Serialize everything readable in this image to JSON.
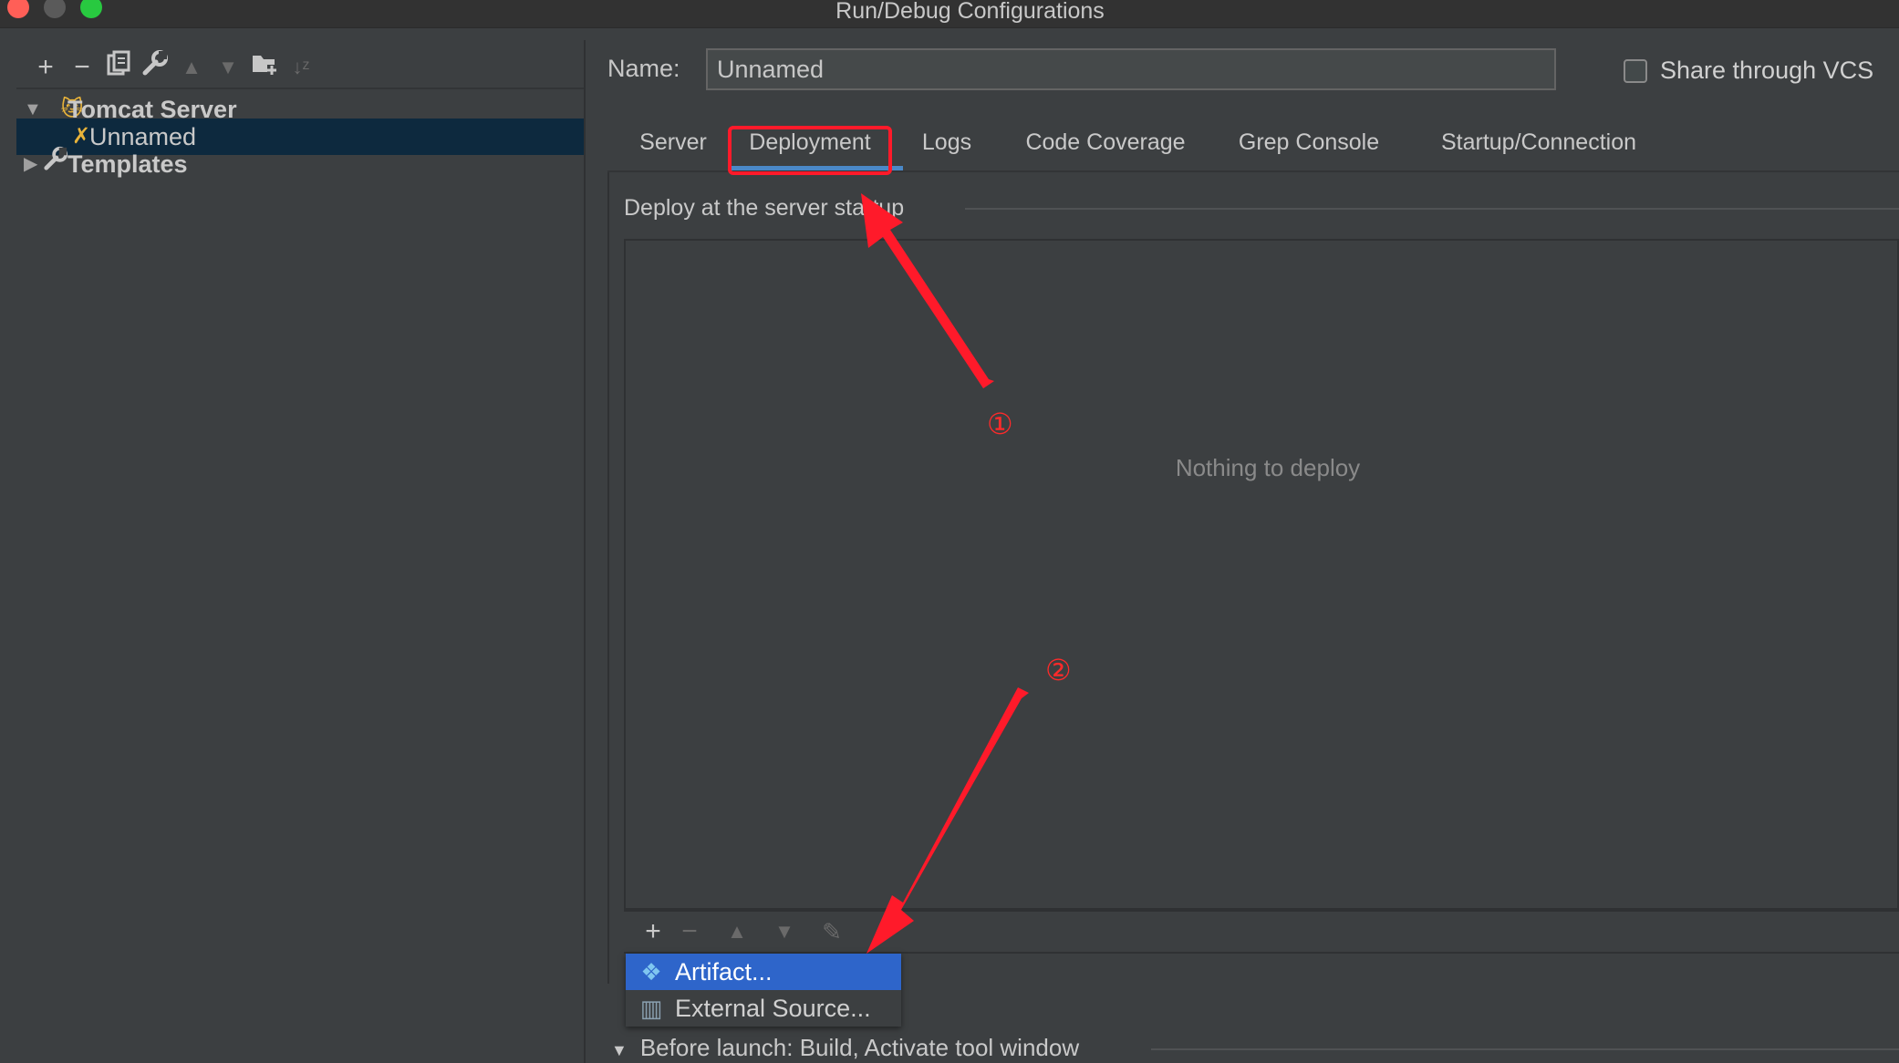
{
  "window": {
    "title": "Run/Debug Configurations"
  },
  "left_toolbar": {
    "icons": [
      "add-icon",
      "remove-icon",
      "copy-icon",
      "wrench-icon",
      "move-up-icon",
      "move-down-icon",
      "folder-add-icon",
      "sort-icon"
    ]
  },
  "tree": {
    "items": [
      {
        "label": "Tomcat Server",
        "expanded": true,
        "icon": "tomcat-icon"
      },
      {
        "label": "Unnamed",
        "selected": true,
        "icon": "tomcat-config-icon"
      },
      {
        "label": "Templates",
        "expanded": false,
        "icon": "wrench-icon"
      }
    ]
  },
  "form": {
    "name_label": "Name:",
    "name_value": "Unnamed",
    "share_label": "Share through VCS",
    "share_checked": false
  },
  "tabs": [
    {
      "label": "Server"
    },
    {
      "label": "Deployment",
      "active": true
    },
    {
      "label": "Logs"
    },
    {
      "label": "Code Coverage"
    },
    {
      "label": "Grep Console"
    },
    {
      "label": "Startup/Connection"
    }
  ],
  "deploy": {
    "section_title": "Deploy at the server startup",
    "empty_text": "Nothing to deploy"
  },
  "list_toolbar": {
    "icons": [
      "add-icon",
      "remove-icon",
      "move-up-icon",
      "move-down-icon",
      "edit-icon"
    ]
  },
  "popup": {
    "items": [
      {
        "label": "Artifact...",
        "icon": "artifact-icon",
        "active": true
      },
      {
        "label": "External Source...",
        "icon": "external-source-icon"
      }
    ]
  },
  "before_launch": {
    "label": "Before launch: Build, Activate tool window"
  },
  "annotations": {
    "step1": "①",
    "step2": "②",
    "color": "#ff1a2a"
  },
  "colors": {
    "background": "#3c3f41",
    "selection": "#0d293e",
    "tab_underline": "#4a88c7",
    "popup_active": "#2e65ca"
  }
}
